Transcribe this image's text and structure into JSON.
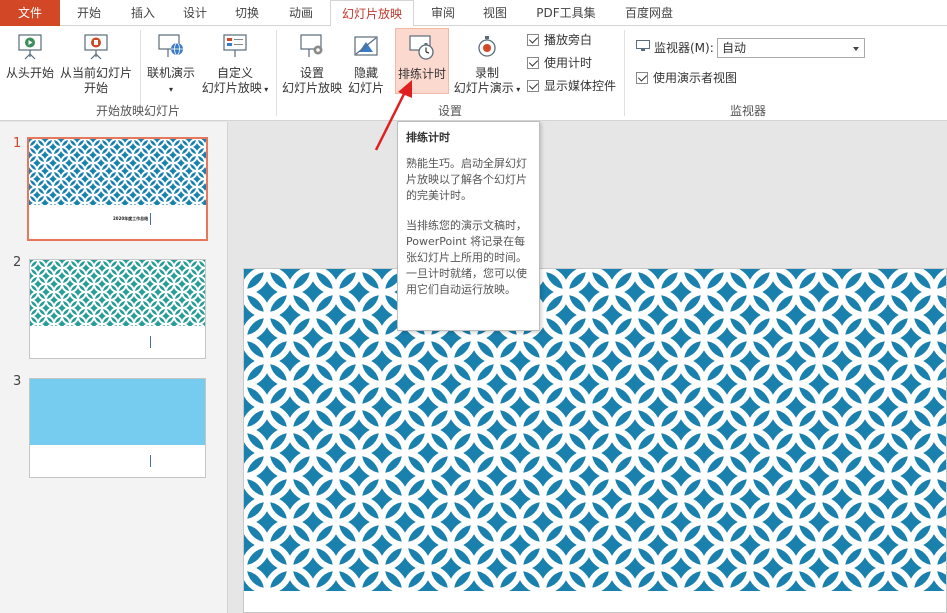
{
  "tabs": [
    {
      "label": "文件"
    },
    {
      "label": "开始"
    },
    {
      "label": "插入"
    },
    {
      "label": "设计"
    },
    {
      "label": "切换"
    },
    {
      "label": "动画"
    },
    {
      "label": "幻灯片放映"
    },
    {
      "label": "审阅"
    },
    {
      "label": "视图"
    },
    {
      "label": "PDF工具集"
    },
    {
      "label": "百度网盘"
    }
  ],
  "ribbon": {
    "start_group": {
      "from_beginning": "从头开始",
      "from_current_1": "从当前幻灯片",
      "from_current_2": "开始",
      "online_present": "联机演示",
      "custom_1": "自定义",
      "custom_2": "幻灯片放映",
      "label": "开始放映幻灯片"
    },
    "setup_group": {
      "setup_1": "设置",
      "setup_2": "幻灯片放映",
      "hide_1": "隐藏",
      "hide_2": "幻灯片",
      "rehearse": "排练计时",
      "record_1": "录制",
      "record_2": "幻灯片演示",
      "chk_narration": "播放旁白",
      "chk_timing": "使用计时",
      "chk_media": "显示媒体控件",
      "label": "设置"
    },
    "monitor_group": {
      "monitor_label": "监视器(M):",
      "monitor_value": "自动",
      "presenter_view": "使用演示者视图",
      "label": "监视器"
    }
  },
  "tooltip": {
    "title": "排练计时",
    "para1": "熟能生巧。启动全屏幻灯片放映以了解各个幻灯片的完美计时。",
    "para2": "当排练您的演示文稿时，PowerPoint 将记录在每张幻灯片上所用的时间。一旦计时就绪，您可以使用它们自动运行放映。"
  },
  "slides": [
    {
      "number": "1",
      "caption": "2020年度工作总结"
    },
    {
      "number": "2"
    },
    {
      "number": "3"
    }
  ],
  "colors": {
    "accent": "#d24726",
    "pattern_blue": "#1a80ad",
    "pattern_teal": "#2a9c97",
    "slide3_blue": "#75ccef"
  }
}
